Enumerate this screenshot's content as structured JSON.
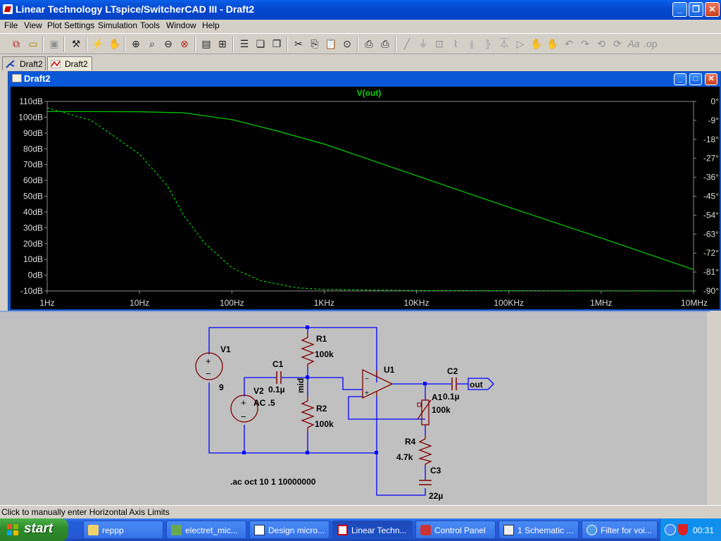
{
  "window": {
    "title": "Linear Technology LTspice/SwitcherCAD III - Draft2"
  },
  "menu": [
    "File",
    "View",
    "Plot Settings",
    "Simulation",
    "Tools",
    "Window",
    "Help"
  ],
  "tabs": [
    {
      "label": "Draft2",
      "kind": "schematic"
    },
    {
      "label": "Draft2",
      "kind": "waveform"
    }
  ],
  "plot_window": {
    "title": "Draft2"
  },
  "chart_data": {
    "type": "line",
    "title": "V(out)",
    "x_scale": "log",
    "x_ticks": [
      "1Hz",
      "10Hz",
      "100Hz",
      "1KHz",
      "10KHz",
      "100KHz",
      "1MHz",
      "10MHz"
    ],
    "y_ticks_left": [
      "110dB",
      "100dB",
      "90dB",
      "80dB",
      "70dB",
      "60dB",
      "50dB",
      "40dB",
      "30dB",
      "20dB",
      "10dB",
      "0dB",
      "-10dB"
    ],
    "y_ticks_right": [
      "0°",
      "-9°",
      "-18°",
      "-27°",
      "-36°",
      "-45°",
      "-54°",
      "-63°",
      "-72°",
      "-81°",
      "-90°"
    ],
    "xlim_hz": [
      1,
      10000000
    ],
    "ylim_db": [
      -10,
      110
    ],
    "ylim_deg": [
      -90,
      0
    ],
    "grid": false,
    "series": [
      {
        "style": "solid",
        "color": "#00d200",
        "x": [
          1,
          10,
          30,
          100,
          300,
          1000,
          10000,
          100000,
          1000000,
          10000000
        ],
        "y": [
          103.6,
          103.5,
          102.8,
          98.5,
          91.5,
          83,
          63,
          43,
          23.5,
          3.5
        ]
      },
      {
        "style": "dashed",
        "color": "#00d200",
        "x": [
          1,
          3,
          10,
          20,
          30,
          50,
          100,
          200,
          500,
          1000,
          10000,
          10000000
        ],
        "y": [
          -3,
          -9,
          -25,
          -40,
          -54,
          -67,
          -79,
          -85,
          -88.5,
          -89.3,
          -89.8,
          -90
        ]
      }
    ]
  },
  "schematic": {
    "components": [
      {
        "ref": "V1",
        "value": "9"
      },
      {
        "ref": "V2",
        "value": "AC .5"
      },
      {
        "ref": "C1",
        "value": "0.1µ"
      },
      {
        "ref": "R1",
        "value": "100k"
      },
      {
        "ref": "R2",
        "value": "100k"
      },
      {
        "ref": "U1",
        "value": ""
      },
      {
        "ref": "C2",
        "value": "0.1µ"
      },
      {
        "ref": "A1",
        "value": "100k"
      },
      {
        "ref": "R4",
        "value": "4.7k"
      },
      {
        "ref": "C3",
        "value": "22µ"
      }
    ],
    "net_mid": "mid",
    "net_out": "out",
    "directive": ".ac oct 10 1 10000000"
  },
  "status": "Click to manually enter Horizontal Axis Limits",
  "taskbar": {
    "start": "start",
    "tasks": [
      "reppp",
      "electret_mic...",
      "Design micro...",
      "Linear Techn...",
      "Control Panel",
      "1 Schematic ...",
      "Filter for voi..."
    ],
    "clock": "00:31"
  },
  "colors": {
    "trace": "#00d200",
    "wire": "#0000ff",
    "component": "#800000",
    "plot_bg": "#000000"
  }
}
